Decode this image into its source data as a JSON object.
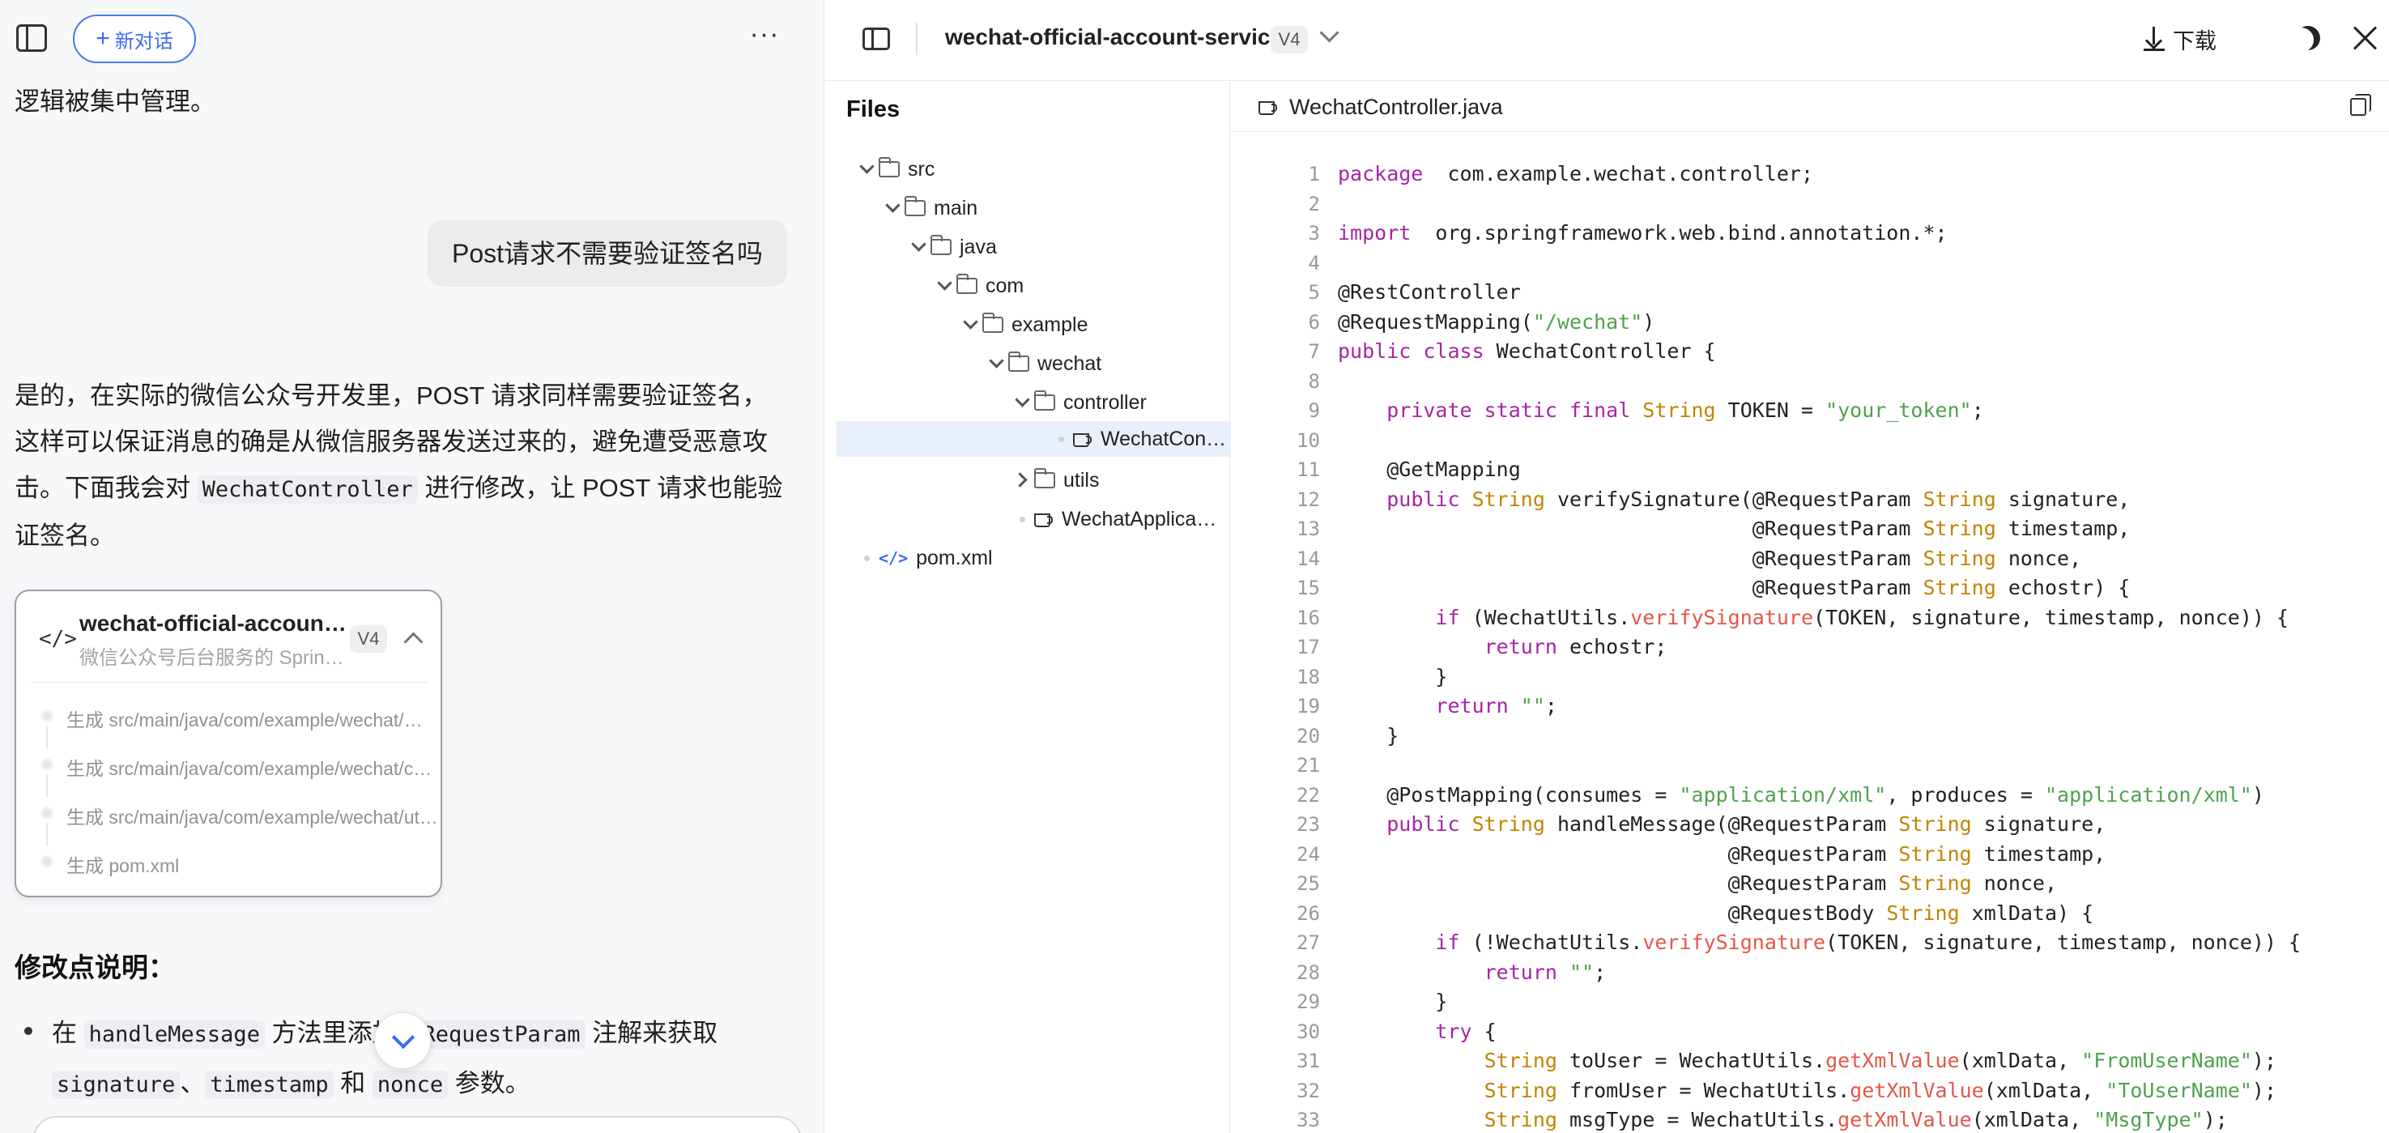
{
  "chat": {
    "new_chat_label": "新对话",
    "more_label": "···",
    "p_before": "逻辑被集中管理。",
    "user_message": "Post请求不需要验证签名吗",
    "answer_part1": "是的，在实际的微信公众号开发里，POST 请求同样需要验证签名，这样可以保证消息的确是从微信服务器发送过来的，避免遭受恶意攻击。下面我会对 ",
    "answer_code": "WechatController",
    "answer_part2": " 进行修改，让 POST 请求也能验证签名。",
    "card": {
      "icon": "</>",
      "title": "wechat-official-account-service",
      "subtitle": "微信公众号后台服务的 Spring Boot 项目",
      "version": "V4",
      "steps": [
        "生成 src/main/java/com/example/wechat/WechatApplication.java",
        "生成 src/main/java/com/example/wechat/controller/WechatController.java",
        "生成 src/main/java/com/example/wechat/utils/WechatUtils.java",
        "生成 pom.xml"
      ]
    },
    "section_heading": "修改点说明：",
    "bullet": {
      "pre": "在 ",
      "code1": "handleMessage",
      "mid": " 方法里添加 ",
      "code2": "@RequestParam",
      "mid2": " 注解来获取 ",
      "code3": "signature",
      "sep1": "、",
      "code4": "timestamp",
      "sep2": " 和 ",
      "code5": "nonce",
      "post": " 参数。"
    }
  },
  "topbar": {
    "project_title": "wechat-official-account-service",
    "version": "V4",
    "download_label": "下载"
  },
  "files": {
    "heading": "Files",
    "tree": [
      {
        "label": "src"
      },
      {
        "label": "main"
      },
      {
        "label": "java"
      },
      {
        "label": "com"
      },
      {
        "label": "example"
      },
      {
        "label": "wechat"
      },
      {
        "label": "controller"
      },
      {
        "label": "WechatController.java"
      },
      {
        "label": "utils"
      },
      {
        "label": "WechatApplication.java"
      },
      {
        "label": "pom.xml"
      }
    ]
  },
  "editor": {
    "tab_name": "WechatController.java",
    "lines": [
      [
        [
          "kw",
          "package"
        ],
        [
          "",
          "  com.example.wechat.controller;"
        ]
      ],
      [],
      [
        [
          "kw",
          "import"
        ],
        [
          "",
          "  org.springframework.web.bind.annotation.*;"
        ]
      ],
      [],
      [
        [
          "",
          "@RestController"
        ]
      ],
      [
        [
          "",
          "@RequestMapping("
        ],
        [
          "st",
          "\"/wechat\""
        ],
        [
          "",
          ")"
        ]
      ],
      [
        [
          "kw",
          "public class"
        ],
        [
          "",
          " WechatController {"
        ]
      ],
      [],
      [
        [
          "",
          "    "
        ],
        [
          "kw",
          "private static final"
        ],
        [
          "",
          ""
        ],
        [
          "ty",
          " String"
        ],
        [
          "",
          " TOKEN = "
        ],
        [
          "st",
          "\"your_token\""
        ],
        [
          "",
          ";"
        ]
      ],
      [],
      [
        [
          "",
          "    @GetMapping"
        ]
      ],
      [
        [
          "",
          "    "
        ],
        [
          "kw",
          "public"
        ],
        [
          "ty",
          " String"
        ],
        [
          "",
          " verifySignature(@RequestParam "
        ],
        [
          "ty",
          "String"
        ],
        [
          "",
          " signature,"
        ]
      ],
      [
        [
          "",
          "                                  @RequestParam "
        ],
        [
          "ty",
          "String"
        ],
        [
          "",
          " timestamp,"
        ]
      ],
      [
        [
          "",
          "                                  @RequestParam "
        ],
        [
          "ty",
          "String"
        ],
        [
          "",
          " nonce,"
        ]
      ],
      [
        [
          "",
          "                                  @RequestParam "
        ],
        [
          "ty",
          "String"
        ],
        [
          "",
          " echostr) {"
        ]
      ],
      [
        [
          "",
          "        "
        ],
        [
          "kw",
          "if"
        ],
        [
          "",
          " (WechatUtils."
        ],
        [
          "fn",
          "verifySignature"
        ],
        [
          "",
          "(TOKEN, signature, timestamp, nonce)) {"
        ]
      ],
      [
        [
          "",
          "            "
        ],
        [
          "kw",
          "return"
        ],
        [
          "",
          " echostr;"
        ]
      ],
      [
        [
          "",
          "        }"
        ]
      ],
      [
        [
          "",
          "        "
        ],
        [
          "kw",
          "return"
        ],
        [
          "",
          " "
        ],
        [
          "st",
          "\"\""
        ],
        [
          "",
          ";"
        ]
      ],
      [
        [
          "",
          "    }"
        ]
      ],
      [],
      [
        [
          "",
          "    @PostMapping(consumes = "
        ],
        [
          "st",
          "\"application/xml\""
        ],
        [
          "",
          ", produces = "
        ],
        [
          "st",
          "\"application/xml\""
        ],
        [
          "",
          ")"
        ]
      ],
      [
        [
          "",
          "    "
        ],
        [
          "kw",
          "public"
        ],
        [
          "ty",
          " String"
        ],
        [
          "",
          " handleMessage(@RequestParam "
        ],
        [
          "ty",
          "String"
        ],
        [
          "",
          " signature,"
        ]
      ],
      [
        [
          "",
          "                                @RequestParam "
        ],
        [
          "ty",
          "String"
        ],
        [
          "",
          " timestamp,"
        ]
      ],
      [
        [
          "",
          "                                @RequestParam "
        ],
        [
          "ty",
          "String"
        ],
        [
          "",
          " nonce,"
        ]
      ],
      [
        [
          "",
          "                                @RequestBody "
        ],
        [
          "ty",
          "String"
        ],
        [
          "",
          " xmlData) {"
        ]
      ],
      [
        [
          "",
          "        "
        ],
        [
          "kw",
          "if"
        ],
        [
          "",
          " (!WechatUtils."
        ],
        [
          "fn",
          "verifySignature"
        ],
        [
          "",
          "(TOKEN, signature, timestamp, nonce)) {"
        ]
      ],
      [
        [
          "",
          "            "
        ],
        [
          "kw",
          "return"
        ],
        [
          "",
          " "
        ],
        [
          "st",
          "\"\""
        ],
        [
          "",
          ";"
        ]
      ],
      [
        [
          "",
          "        }"
        ]
      ],
      [
        [
          "",
          "        "
        ],
        [
          "kw",
          "try"
        ],
        [
          "",
          " {"
        ]
      ],
      [
        [
          "",
          "            "
        ],
        [
          "ty",
          "String"
        ],
        [
          "",
          " toUser = WechatUtils."
        ],
        [
          "fn",
          "getXmlValue"
        ],
        [
          "",
          "(xmlData, "
        ],
        [
          "st",
          "\"FromUserName\""
        ],
        [
          "",
          ");"
        ]
      ],
      [
        [
          "",
          "            "
        ],
        [
          "ty",
          "String"
        ],
        [
          "",
          " fromUser = WechatUtils."
        ],
        [
          "fn",
          "getXmlValue"
        ],
        [
          "",
          "(xmlData, "
        ],
        [
          "st",
          "\"ToUserName\""
        ],
        [
          "",
          ");"
        ]
      ],
      [
        [
          "",
          "            "
        ],
        [
          "ty",
          "String"
        ],
        [
          "",
          " msgType = WechatUtils."
        ],
        [
          "fn",
          "getXmlValue"
        ],
        [
          "",
          "(xmlData, "
        ],
        [
          "st",
          "\"MsgType\""
        ],
        [
          "",
          ");"
        ]
      ]
    ]
  }
}
